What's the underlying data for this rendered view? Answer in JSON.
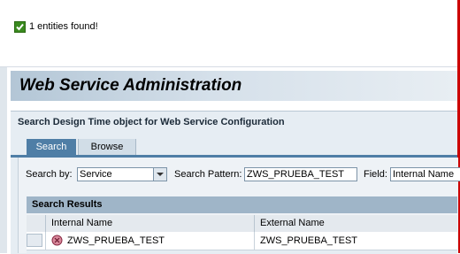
{
  "message": {
    "text": "1 entities found!",
    "icon": "success-check-icon"
  },
  "header": {
    "title": "Web Service Administration"
  },
  "panel": {
    "title": "Search Design Time object for Web Service Configuration"
  },
  "tabs": [
    {
      "label": "Search",
      "active": true
    },
    {
      "label": "Browse",
      "active": false
    }
  ],
  "search": {
    "search_by_label": "Search by:",
    "search_by_value": "Service",
    "pattern_label": "Search Pattern:",
    "pattern_value": "ZWS_PRUEBA_TEST",
    "field_label": "Field:",
    "field_value": "Internal Name"
  },
  "results": {
    "title": "Search Results",
    "columns": [
      "Internal Name",
      "External Name"
    ],
    "rows": [
      {
        "internal_name": "ZWS_PRUEBA_TEST",
        "external_name": "ZWS_PRUEBA_TEST",
        "icon": "service-definition-icon"
      }
    ]
  },
  "colors": {
    "accent": "#4f7ea6",
    "header_bg": "#b3c6d6",
    "success": "#3a8a1f"
  }
}
